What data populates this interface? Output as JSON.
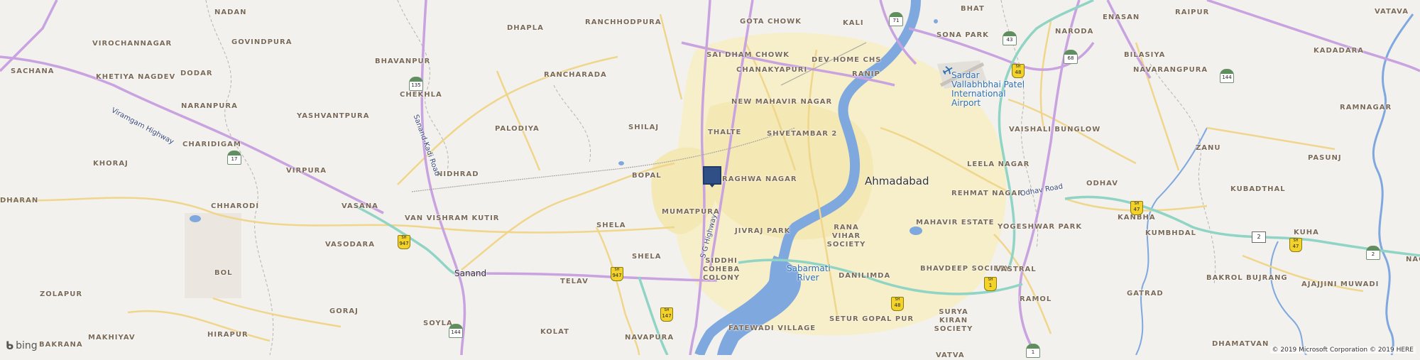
{
  "map": {
    "city_label": "Ahmadabad",
    "place_labels": [
      "NADAN",
      "GOTA CHOWK",
      "KALI",
      "BHAT",
      "RAIPUR",
      "VATAVA",
      "VIROCHANNAGAR",
      "GOVINDPURA",
      "RANCHHODPURA",
      "DHAPLA",
      "SAI DHAM CHOWK",
      "DEV HOME CHS",
      "SONA PARK",
      "NARODA",
      "ENASAN",
      "SACHANA",
      "DODAR",
      "BHAVANPUR",
      "CHANAKYAPURI",
      "RANIP",
      "BILASIYA",
      "KADADARA",
      "KHETIYA NAGDEV",
      "RANCHARADA",
      "CHEKHLA",
      "NEW MAHAVIR NAGAR",
      "NAVARANGPURA",
      "NARANPURA",
      "YASHVANTPURA",
      "RAMNAGAR",
      "PALODIYA",
      "SHILAJ",
      "THALTE",
      "SHVETAMBAR 2",
      "VAISHALI BUNGLOW",
      "ZANU",
      "CHARIDIGAM",
      "KHORAJ",
      "VIRPURA",
      "BOPAL",
      "RAGHWA NAGAR",
      "LEELA NAGAR",
      "PASUNJ",
      "NIDHRAD",
      "REHMAT NAGAR",
      "ODHAV",
      "KUBADTHAL",
      "CHHARODI",
      "VASANA",
      "MUMATPURA",
      "KANBHA",
      "VAN VISHRAM KUTIR",
      "SHELA",
      "JIVRAJ PARK",
      "RANA VIHAR SOCIETY",
      "MAHAVIR ESTATE",
      "YOGESHWAR PARK",
      "KUMBHDAL",
      "KUHA",
      "VASODARA",
      "SHELA",
      "SIDDHI COHEBA COLONY",
      "TELAV",
      "DANILIMDA",
      "BHAVDEEP SOCIETY",
      "VASTRAL",
      "BOL",
      "ZOLAPUR",
      "GATRAD",
      "BAKROL BUJRANG",
      "AJAJJINI MUWADI",
      "RAMOL",
      "GORAJ",
      "SOYLA",
      "SETUR GOPAL PUR",
      "SURYA KIRAN SOCIETY",
      "MAKHIYAV",
      "HIRAPUR",
      "KOLAT",
      "FATEWADI VILLAGE",
      "NAVAPURA",
      "DHAMATVAN",
      "BAKRANA",
      "Sanand",
      "DHARAN",
      "VATVA",
      "NAGEL"
    ],
    "water_labels": [
      "Sabarmati River"
    ],
    "airport_label": "Sardar Vallabhbhai Patel International Airport",
    "road_labels": [
      "Viramgam Highway",
      "Sanand-Kadi Road",
      "S G Highway",
      "Odhav Road"
    ],
    "route_shields": [
      "71",
      "43",
      "48",
      "68",
      "144",
      "135",
      "17",
      "947",
      "947",
      "147",
      "48",
      "1",
      "47",
      "2",
      "47",
      "2",
      "144",
      "1"
    ],
    "colors": {
      "land": "#f2f1ee",
      "urban": "#f5efc8",
      "major_road": "#c9a2e0",
      "secondary_road": "#f0d68a",
      "expressway": "#8fd4c4",
      "water": "#7fa8df",
      "pin": "#2f4f86"
    },
    "icons": [
      "pin-icon",
      "airplane-icon",
      "bing-logo-icon"
    ]
  },
  "attribution": {
    "logo_text": "bing",
    "copyright": "© 2019 Microsoft Corporation © 2019 HERE"
  }
}
